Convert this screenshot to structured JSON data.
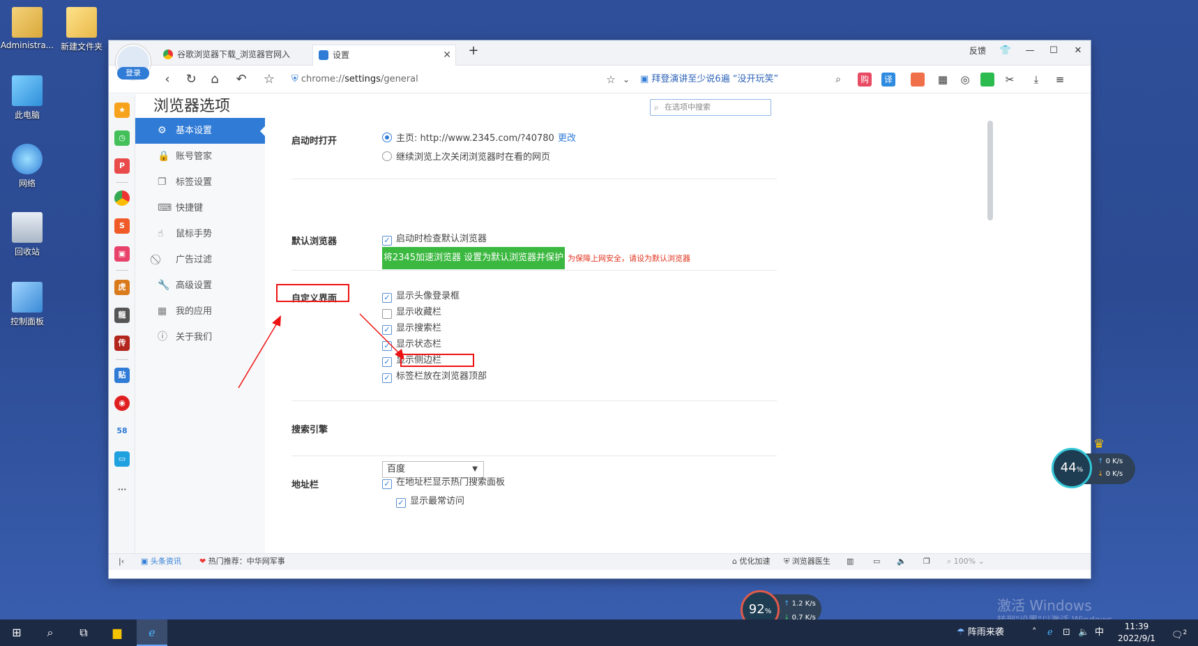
{
  "desktop": {
    "icons": [
      {
        "label": "Administra..."
      },
      {
        "label": "新建文件夹"
      },
      {
        "label": "此电脑"
      },
      {
        "label": "网络"
      },
      {
        "label": "回收站"
      },
      {
        "label": "控制面板"
      }
    ],
    "watermark_line1": "激活 Windows",
    "watermark_line2": "转到\"设置\"以激活 Windows。"
  },
  "window": {
    "login_label": "登录",
    "tabs": [
      {
        "label": "谷歌浏览器下载_浏览器官网入"
      },
      {
        "label": "设置"
      }
    ],
    "new_tab": "+",
    "controls": {
      "feedback": "反馈",
      "skin": "👕",
      "minimize": "—",
      "maximize": "☐",
      "close": "✕"
    }
  },
  "navbar": {
    "url_prefix": "chrome://",
    "url_bold": "settings",
    "url_suffix": "/general",
    "hot_search": "拜登演讲至少说6遍 “没开玩笑”",
    "toolbar": [
      "购",
      "译"
    ]
  },
  "settings": {
    "title": "浏览器选项",
    "search_placeholder": "在选项中搜索",
    "menu": [
      {
        "label": "基本设置",
        "icon": "⚙"
      },
      {
        "label": "账号管家",
        "icon": "🔒"
      },
      {
        "label": "标签设置",
        "icon": "❐"
      },
      {
        "label": "快捷键",
        "icon": "⌨"
      },
      {
        "label": "鼠标手势",
        "icon": "☝"
      },
      {
        "label": "广告过滤",
        "icon": "⃠"
      },
      {
        "label": "高级设置",
        "icon": "🔧"
      },
      {
        "label": "我的应用",
        "icon": "▦"
      },
      {
        "label": "关于我们",
        "icon": "ⓘ"
      }
    ],
    "startup": {
      "label": "启动时打开",
      "home_option": "主页: http://www.2345.com/?40780",
      "change_link": "更改",
      "continue_option": "继续浏览上次关闭浏览器时在看的网页"
    },
    "default_browser": {
      "label": "默认浏览器",
      "button": "将2345加速浏览器 设置为默认浏览器并保护",
      "tip": "为保障上网安全，请设为默认浏览器",
      "check_on_start": "启动时检查默认浏览器"
    },
    "custom_ui": {
      "label": "自定义界面",
      "options": [
        {
          "label": "显示头像登录框",
          "checked": true
        },
        {
          "label": "显示收藏栏",
          "checked": false
        },
        {
          "label": "显示搜索栏",
          "checked": true
        },
        {
          "label": "显示状态栏",
          "checked": true
        },
        {
          "label": "显示侧边栏",
          "checked": true
        },
        {
          "label": "标签栏放在浏览器顶部",
          "checked": true
        }
      ]
    },
    "search_engine": {
      "label": "搜索引擎",
      "value": "百度"
    },
    "address_bar": {
      "label": "地址栏",
      "opt1": "在地址栏显示热门搜索面板",
      "opt2": "显示最常访问"
    }
  },
  "statusbar": {
    "news": "头条资讯",
    "hot": "热门推荐：中华网军事",
    "optimize": "优化加速",
    "doctor": "浏览器医生",
    "zoom": "100%"
  },
  "widgets": {
    "gauge_right": {
      "value": "44",
      "unit": "%",
      "up": "0 K/s",
      "down": "0 K/s"
    },
    "gauge_bottom": {
      "value": "92",
      "unit": "%",
      "up": "1.2 K/s",
      "down": "0.7 K/s"
    }
  },
  "taskbar": {
    "weather": "阵雨来袭",
    "ime": "中",
    "time": "11:39",
    "date": "2022/9/1",
    "notifications": "2"
  },
  "colors": {
    "accent": "#2f7bd6",
    "green": "#3bb83f",
    "annotation": "#e11111"
  }
}
